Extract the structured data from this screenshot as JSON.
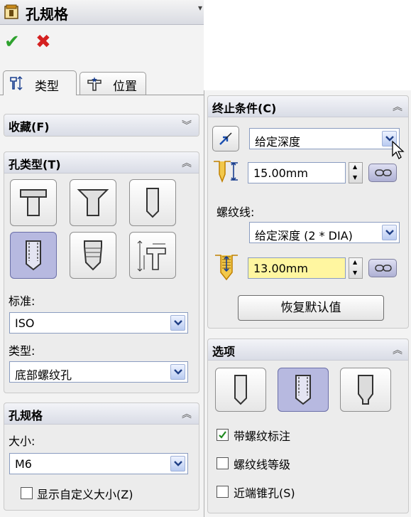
{
  "window": {
    "title": "孔规格"
  },
  "actions": {
    "ok_icon": "check-icon",
    "cancel_icon": "close-icon"
  },
  "tabs": [
    {
      "label": "类型"
    },
    {
      "label": "位置"
    }
  ],
  "favorites": {
    "title": "收藏(F)"
  },
  "hole_type": {
    "title": "孔类型(T)",
    "buttons": [
      "counterbore",
      "countersink",
      "hole",
      "tapped-hole",
      "pipe-tap",
      "legacy-hole"
    ],
    "selected": "tapped-hole",
    "standard_label": "标准:",
    "standard_value": "ISO",
    "type_label": "类型:",
    "type_value": "底部螺纹孔"
  },
  "hole_spec": {
    "title": "孔规格",
    "size_label": "大小:",
    "size_value": "M6",
    "custom_size_label": "显示自定义大小(Z)",
    "custom_size_checked": false
  },
  "end_condition": {
    "title": "终止条件(C)",
    "condition_value": "给定深度",
    "depth_value": "15.00mm",
    "thread_label": "螺纹线:",
    "thread_condition_value": "给定深度 (2 * DIA)",
    "thread_depth_value": "13.00mm",
    "restore_label": "恢复默认值"
  },
  "options": {
    "title": "选项",
    "thread_annotation_label": "带螺纹标注",
    "thread_annotation_checked": true,
    "thread_class_label": "螺纹线等级",
    "thread_class_checked": false,
    "near_countersink_label": "近端锥孔(S)",
    "near_countersink_checked": false
  },
  "colors": {
    "accent_selected": "#b7b9e0",
    "ok": "#2ea22e",
    "cancel": "#d42020",
    "depth_field": "#fff6a0"
  }
}
